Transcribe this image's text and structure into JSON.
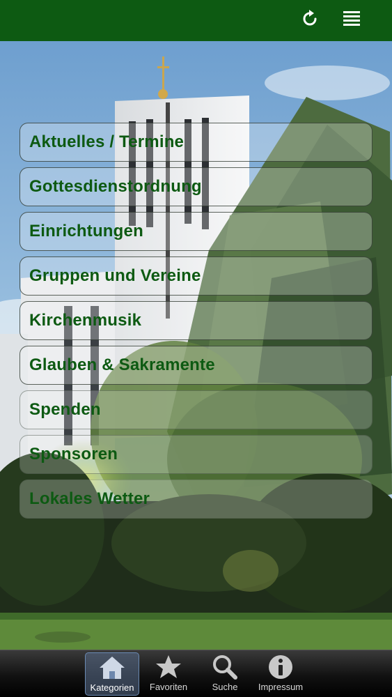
{
  "header": {
    "refresh_icon": "refresh-icon",
    "menu_icon": "hamburger-menu-icon",
    "bar_color": "#0d5a12"
  },
  "menu": {
    "items": [
      {
        "label": "Aktuelles / Termine"
      },
      {
        "label": "Gottesdienstordnung"
      },
      {
        "label": "Einrichtungen"
      },
      {
        "label": "Gruppen und Vereine"
      },
      {
        "label": "Kirchenmusik"
      },
      {
        "label": "Glauben & Sakramente"
      },
      {
        "label": "Spenden"
      },
      {
        "label": "Sponsoren"
      },
      {
        "label": "Lokales Wetter"
      }
    ],
    "text_color": "#0d5a12"
  },
  "tabbar": {
    "tabs": [
      {
        "label": "Kategorien",
        "icon": "home-icon",
        "active": true
      },
      {
        "label": "Favoriten",
        "icon": "star-icon",
        "active": false
      },
      {
        "label": "Suche",
        "icon": "search-icon",
        "active": false
      },
      {
        "label": "Impressum",
        "icon": "info-icon",
        "active": false
      }
    ]
  }
}
